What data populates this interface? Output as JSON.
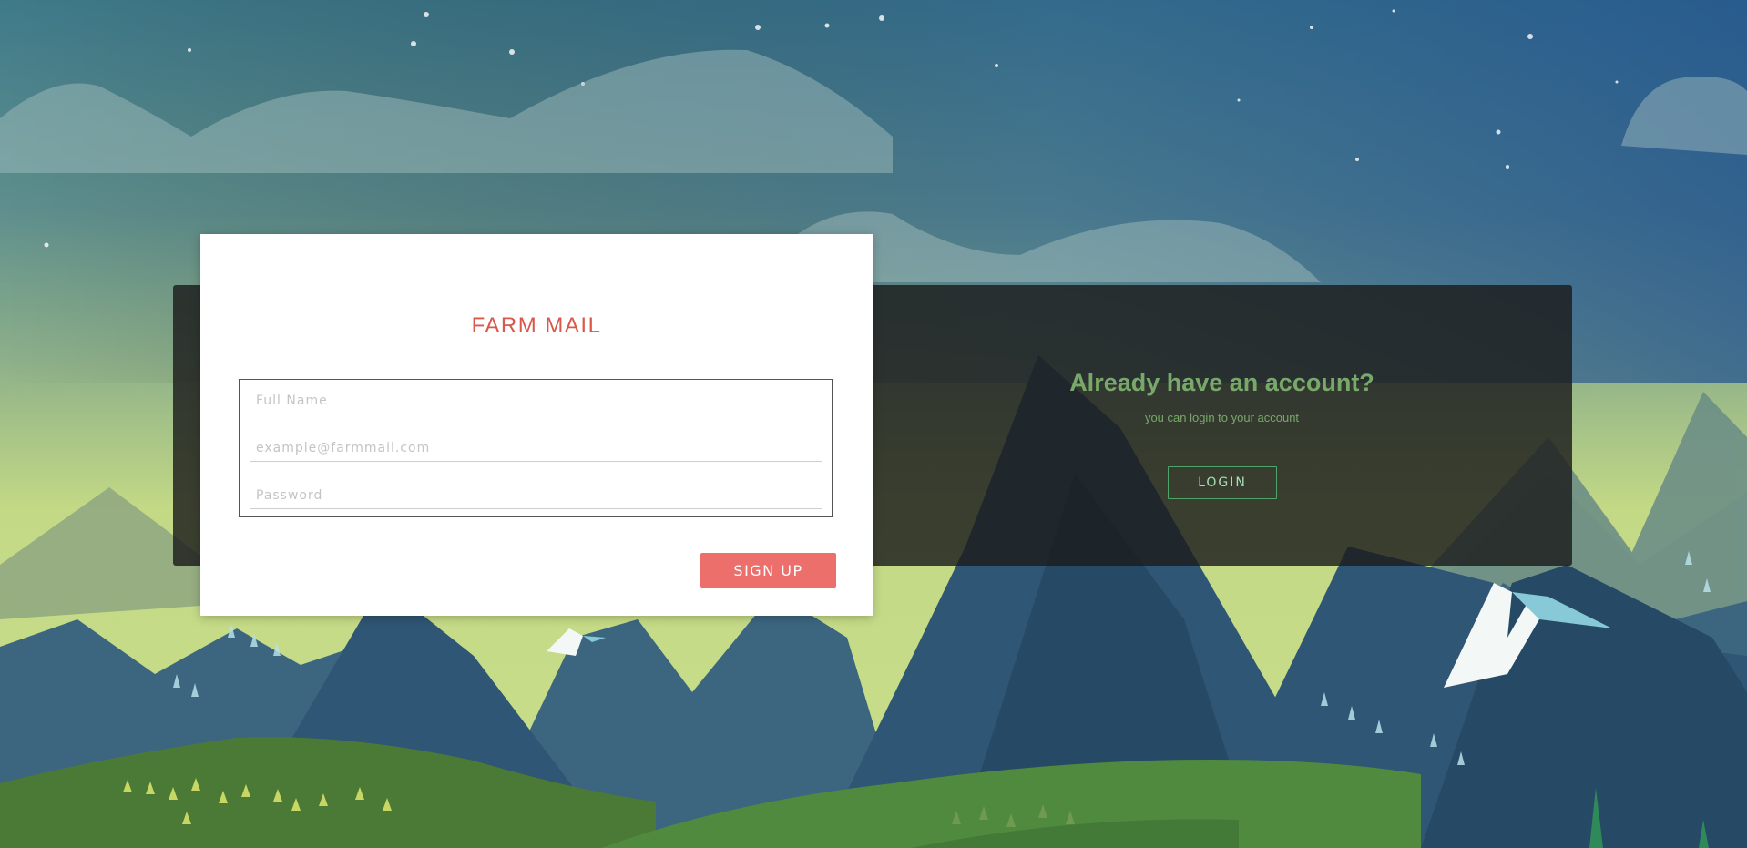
{
  "signup": {
    "title": "FARM MAIL",
    "fields": {
      "full_name_placeholder": "Full Name",
      "email_placeholder": "example@farmmail.com",
      "password_placeholder": "Password"
    },
    "submit_label": "SIGN UP"
  },
  "login_prompt": {
    "heading": "Already have an account?",
    "subtext": "you can login to your account",
    "button_label": "LOGIN"
  },
  "colors": {
    "brand_red": "#d9574b",
    "button_red": "#ec6f6b",
    "login_green": "#78a96a",
    "panel_dark": "#1c1c1c"
  }
}
